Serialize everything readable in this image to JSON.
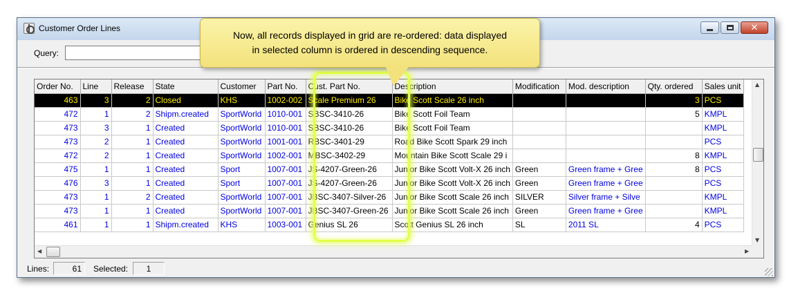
{
  "window": {
    "title": "Customer Order Lines"
  },
  "query": {
    "label": "Query:",
    "value": ""
  },
  "grid": {
    "columns": [
      "Order No.",
      "Line",
      "Release",
      "State",
      "Customer",
      "Part No.",
      "Cust. Part No.",
      "Description",
      "Modification",
      "Mod. description",
      "Qty. ordered",
      "Sales unit"
    ],
    "rows": [
      [
        "463",
        "3",
        "2",
        "Closed",
        "KHS",
        "1002-002",
        "Scale Premium 26",
        "Bike Scott Scale 26 inch",
        "",
        "",
        "3",
        "PCS"
      ],
      [
        "472",
        "1",
        "2",
        "Shipm.created",
        "SportWorld",
        "1010-001",
        "SBSC-3410-26",
        "Bike Scott Foil Team",
        "",
        "",
        "5",
        "KMPL"
      ],
      [
        "473",
        "3",
        "1",
        "Created",
        "SportWorld",
        "1010-001",
        "SBSC-3410-26",
        "Bike Scott Foil Team",
        "",
        "",
        "",
        "KMPL"
      ],
      [
        "473",
        "2",
        "1",
        "Created",
        "SportWorld",
        "1001-001",
        "RBSC-3401-29",
        "Road Bike Scott Spark 29 inch",
        "",
        "",
        "",
        "PCS"
      ],
      [
        "472",
        "2",
        "1",
        "Created",
        "SportWorld",
        "1002-001",
        "MBSC-3402-29",
        "Mountain Bike Scott Scale 29 i",
        "",
        "",
        "8",
        "KMPL"
      ],
      [
        "475",
        "1",
        "1",
        "Created",
        "Sport",
        "1007-001",
        "JS-4207-Green-26",
        "Junior Bike Scott Volt-X 26 inch",
        "Green",
        "Green frame + Gree",
        "8",
        "PCS"
      ],
      [
        "476",
        "3",
        "1",
        "Created",
        "Sport",
        "1007-001",
        "JS-4207-Green-26",
        "Junior Bike Scott Volt-X 26 inch",
        "Green",
        "Green frame + Gree",
        "",
        "PCS"
      ],
      [
        "473",
        "1",
        "2",
        "Created",
        "SportWorld",
        "1007-001",
        "JBSC-3407-Silver-26",
        "Junior Bike Scott Scale 26 inch",
        "SILVER",
        "Silver frame + Silve",
        "",
        "KMPL"
      ],
      [
        "473",
        "1",
        "1",
        "Created",
        "SportWorld",
        "1007-001",
        "JBSC-3407-Green-26",
        "Junior Bike Scott Scale 26 inch",
        "Green",
        "Green frame + Gree",
        "",
        "KMPL"
      ],
      [
        "461",
        "1",
        "1",
        "Shipm.created",
        "KHS",
        "1003-001",
        "Genius SL 26",
        "Scott Genius SL 26 inch",
        "SL",
        "2011 SL",
        "4",
        "PCS"
      ]
    ]
  },
  "status": {
    "lines_label": "Lines:",
    "lines_value": "61",
    "selected_label": "Selected:",
    "selected_value": "1"
  },
  "callout": {
    "line1": "Now, all records displayed in grid are re-ordered: data displayed",
    "line2": "in selected column is ordered in descending sequence."
  },
  "icons": {
    "app": "order-lines-app-icon",
    "scroll_left": "scroll-left-arrow-icon",
    "scroll_right": "scroll-right-arrow-icon",
    "scroll_up": "scroll-up-arrow-icon",
    "scroll_down": "scroll-down-arrow-icon"
  },
  "colors": {
    "highlight": "#e4ff4a",
    "callout_bg": "#f3e27c",
    "row_text": "#0000e0",
    "selected_text": "#ffee00"
  }
}
